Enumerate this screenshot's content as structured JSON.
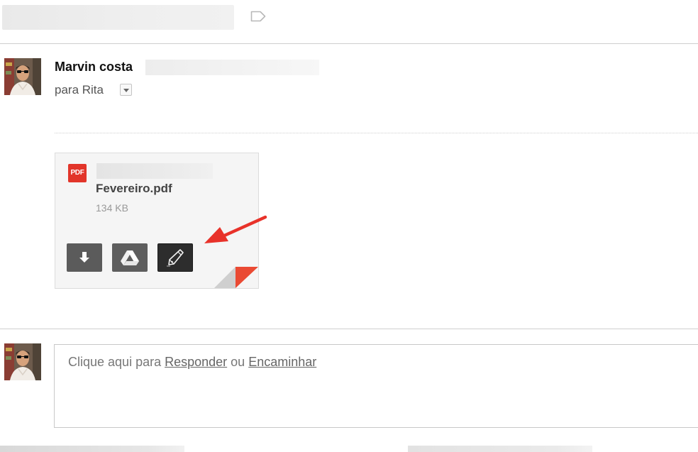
{
  "message": {
    "sender_name": "Marvin costa",
    "recipient_label": "para Rita"
  },
  "attachment": {
    "type_label": "PDF",
    "file_name": "Fevereiro.pdf",
    "file_size": "134 KB"
  },
  "reply": {
    "prefix": "Clique aqui para ",
    "reply_link": "Responder",
    "middle": " ou ",
    "forward_link": "Encaminhar"
  },
  "colors": {
    "pdf_red": "#e2352a",
    "arrow_red": "#e8322a",
    "dark_button": "#5b5b5b",
    "edit_button": "#2d2d2d"
  },
  "icons": {
    "label": "label-tag-icon",
    "download": "download-arrow-icon",
    "drive": "google-drive-icon",
    "edit": "pen-nib-edit-icon"
  }
}
